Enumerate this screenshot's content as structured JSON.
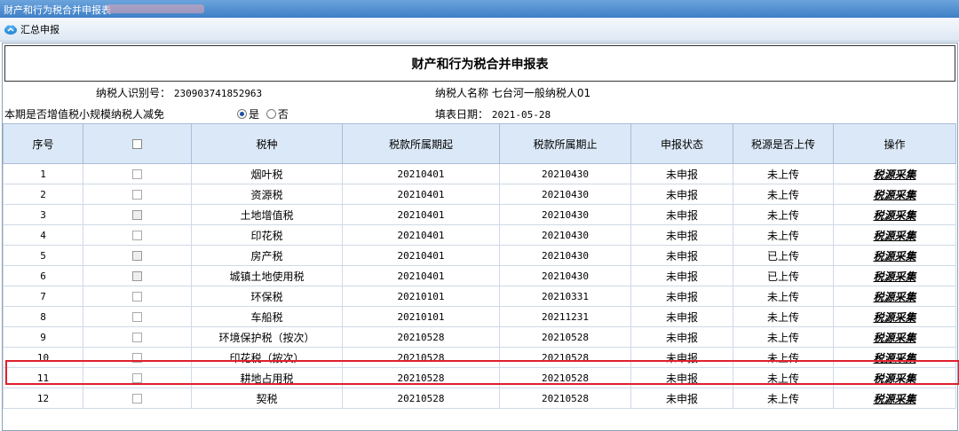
{
  "window": {
    "title": "财产和行为税合并申报表"
  },
  "toolbar": {
    "summary_label": "汇总申报"
  },
  "form": {
    "title": "财产和行为税合并申报表",
    "taxpayer_id_label": "纳税人识别号：",
    "taxpayer_id": "230903741852963",
    "taxpayer_name_label": "纳税人名称",
    "taxpayer_name": "七台河一般纳税人01",
    "relief_label": "本期是否增值税小规模纳税人减免",
    "relief_yes": "是",
    "relief_no": "否",
    "relief_selected": "是",
    "fill_date_label": "填表日期：",
    "fill_date": "2021-05-28"
  },
  "table": {
    "headers": [
      "序号",
      "",
      "税种",
      "税款所属期起",
      "税款所属期止",
      "申报状态",
      "税源是否上传",
      "操作"
    ],
    "rows": [
      {
        "no": "1",
        "tax": "烟叶税",
        "start": "20210401",
        "end": "20210430",
        "status": "未申报",
        "upload": "未上传",
        "action": "税源采集"
      },
      {
        "no": "2",
        "tax": "资源税",
        "start": "20210401",
        "end": "20210430",
        "status": "未申报",
        "upload": "未上传",
        "action": "税源采集"
      },
      {
        "no": "3",
        "tax": "土地增值税",
        "start": "20210401",
        "end": "20210430",
        "status": "未申报",
        "upload": "未上传",
        "action": "税源采集"
      },
      {
        "no": "4",
        "tax": "印花税",
        "start": "20210401",
        "end": "20210430",
        "status": "未申报",
        "upload": "未上传",
        "action": "税源采集"
      },
      {
        "no": "5",
        "tax": "房产税",
        "start": "20210401",
        "end": "20210430",
        "status": "未申报",
        "upload": "已上传",
        "action": "税源采集"
      },
      {
        "no": "6",
        "tax": "城镇土地使用税",
        "start": "20210401",
        "end": "20210430",
        "status": "未申报",
        "upload": "已上传",
        "action": "税源采集"
      },
      {
        "no": "7",
        "tax": "环保税",
        "start": "20210101",
        "end": "20210331",
        "status": "未申报",
        "upload": "未上传",
        "action": "税源采集"
      },
      {
        "no": "8",
        "tax": "车船税",
        "start": "20210101",
        "end": "20211231",
        "status": "未申报",
        "upload": "未上传",
        "action": "税源采集"
      },
      {
        "no": "9",
        "tax": "环境保护税（按次）",
        "start": "20210528",
        "end": "20210528",
        "status": "未申报",
        "upload": "未上传",
        "action": "税源采集"
      },
      {
        "no": "10",
        "tax": "印花税（按次）",
        "start": "20210528",
        "end": "20210528",
        "status": "未申报",
        "upload": "未上传",
        "action": "税源采集"
      },
      {
        "no": "11",
        "tax": "耕地占用税",
        "start": "20210528",
        "end": "20210528",
        "status": "未申报",
        "upload": "未上传",
        "action": "税源采集"
      },
      {
        "no": "12",
        "tax": "契税",
        "start": "20210528",
        "end": "20210528",
        "status": "未申报",
        "upload": "未上传",
        "action": "税源采集"
      }
    ]
  },
  "highlight_row": "8"
}
